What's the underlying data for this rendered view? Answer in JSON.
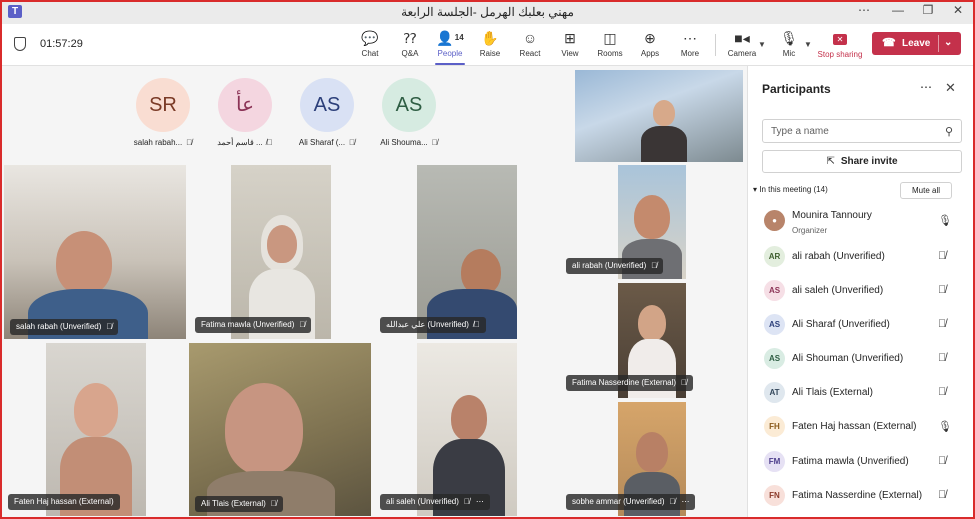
{
  "window": {
    "title": "مهني بعلبك الهرمل -الجلسة الرابعة",
    "app_logo": "T",
    "controls": [
      "⋯",
      "—",
      "❐",
      "✕"
    ]
  },
  "toolbar": {
    "timer": "01:57:29",
    "chat": "Chat",
    "qa": "Q&A",
    "people": "People",
    "people_count": "14",
    "raise": "Raise",
    "react": "React",
    "view": "View",
    "rooms": "Rooms",
    "apps": "Apps",
    "more": "More",
    "camera": "Camera",
    "mic": "Mic",
    "stop_sharing": "Stop sharing",
    "leave": "Leave"
  },
  "avatars": [
    {
      "initials": "SR",
      "name": "salah rabah...",
      "bg": "#f9ddd2",
      "fg": "#7a3a26"
    },
    {
      "initials": "عأ",
      "name": "قاسم أحمد ...",
      "bg": "#f4d6e0",
      "fg": "#8b3356"
    },
    {
      "initials": "AS",
      "name": "Ali Sharaf (...",
      "bg": "#d9e1f4",
      "fg": "#2c3f7a"
    },
    {
      "initials": "AS",
      "name": "Ali Shouma...",
      "bg": "#d6ebe1",
      "fg": "#2e5d43"
    }
  ],
  "videos": [
    {
      "name": "salah rabah (Unverified)"
    },
    {
      "name": "Fatima mawla (Unverified)"
    },
    {
      "name": "علي عبدالله (Unverified)"
    },
    {
      "name": "ali rabah (Unverified)"
    },
    {
      "name": "Fatima Nasserdine (External)"
    },
    {
      "name": "Faten Haj hassan (External)"
    },
    {
      "name": "Ali Tlais (External)"
    },
    {
      "name": "ali saleh (Unverified)"
    },
    {
      "name": "sobhe ammar (Unverified)"
    }
  ],
  "panel": {
    "title": "Participants",
    "search_placeholder": "Type a name",
    "share_invite": "Share invite",
    "section": "In this meeting (14)",
    "mute_all": "Mute all",
    "participants": [
      {
        "initials": "",
        "name": "Mounira Tannoury",
        "role": "Organizer",
        "bg": "#b8846a",
        "fg": "#ffffff",
        "muted": false
      },
      {
        "initials": "AR",
        "name": "ali rabah (Unverified)",
        "bg": "#e3eede",
        "fg": "#3e5e2e",
        "muted": true
      },
      {
        "initials": "AS",
        "name": "ali saleh (Unverified)",
        "bg": "#f6dfe6",
        "fg": "#8b3356",
        "muted": true
      },
      {
        "initials": "AS",
        "name": "Ali Sharaf (Unverified)",
        "bg": "#dde4f4",
        "fg": "#2c3f7a",
        "muted": true
      },
      {
        "initials": "AS",
        "name": "Ali Shouman (Unverified)",
        "bg": "#d9ece3",
        "fg": "#2e5d43",
        "muted": true
      },
      {
        "initials": "AT",
        "name": "Ali Tlais (External)",
        "bg": "#dfe7ee",
        "fg": "#33475b",
        "muted": true
      },
      {
        "initials": "FH",
        "name": "Faten Haj hassan (External)",
        "bg": "#fbebd5",
        "fg": "#8a5a1c",
        "muted": false
      },
      {
        "initials": "FM",
        "name": "Fatima mawla (Unverified)",
        "bg": "#e6e1f4",
        "fg": "#4b3c8a",
        "muted": true
      },
      {
        "initials": "FN",
        "name": "Fatima Nasserdine (External)",
        "bg": "#f8e0da",
        "fg": "#8b3a2a",
        "muted": true
      }
    ]
  },
  "colors": {
    "accent": "#5b5fc7",
    "leave": "#c4314b",
    "border": "#d92b2b"
  },
  "icons": {
    "shield": "shield-icon",
    "chat": "chat-icon",
    "qa": "qa-icon",
    "people": "people-icon",
    "raise": "hand-icon",
    "react": "smile-icon",
    "view": "grid-icon",
    "rooms": "rooms-icon",
    "apps": "plus-icon",
    "more": "ellipsis-icon",
    "camera": "camera-icon",
    "mic": "mic-icon",
    "stop_sharing": "stop-share-icon",
    "leave": "phone-icon",
    "mic_muted": "mic-off-icon"
  }
}
